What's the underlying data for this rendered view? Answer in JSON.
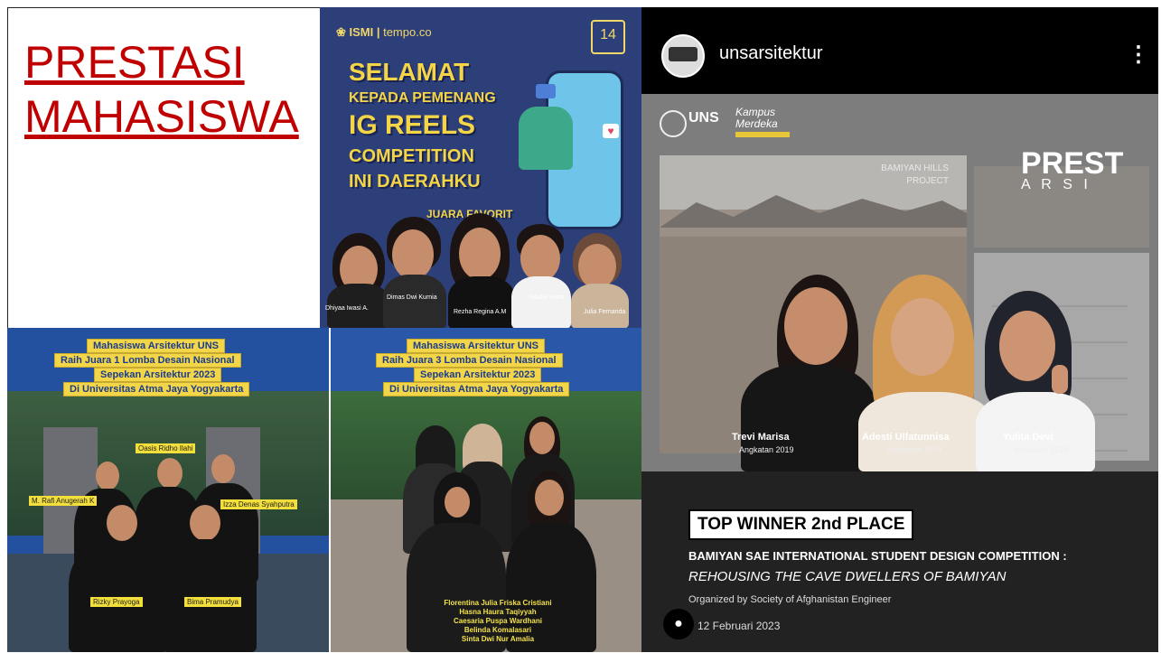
{
  "title": {
    "line1": "PRESTASI",
    "line2": "MAHASISWA"
  },
  "reels": {
    "logo": "tempo.co",
    "headline_1": "SELAMAT",
    "headline_2": "KEPADA PEMENANG",
    "headline_3": "IG REELS",
    "headline_4": "COMPETITION",
    "headline_5": "INI DAERAHKU",
    "subhead": "JUARA FAVORIT",
    "names": [
      "Dhiyaa Iwasi A.",
      "Dimas Dwi Kurnia",
      "Rezha Regina A.M",
      "Naufal Haris",
      "Julia Fernanda"
    ]
  },
  "ig": {
    "username": "unsarsitektur",
    "menu_icon": "more-vertical-icon",
    "logo_uns": "UNS",
    "logo_kampus": "Kampus Merdeka",
    "prest": "PREST",
    "arsi": "A R S I",
    "project": "BAMIYAN HILLS PROJECT",
    "winners": [
      {
        "name": "Trevi Marisa",
        "year": "Angkatan 2019"
      },
      {
        "name": "Adesti Ulfatunnisa",
        "year": "Angkatan 2019"
      },
      {
        "name": "Yulita Devi",
        "year": "Angkatan 2019"
      }
    ],
    "award": "TOP WINNER 2nd PLACE",
    "competition": "BAMIYAN SAE INTERNATIONAL STUDENT DESIGN COMPETITION :",
    "subtitle": "REHOUSING THE CAVE DWELLERS OF BAMIYAN",
    "organizer": "Organized by Society of Afghanistan Engineer",
    "date": "12 Februari 2023",
    "colors": {
      "header": "#000000",
      "panel": "#222222"
    }
  },
  "juara1": {
    "banner": [
      "Mahasiswa Arsitektur UNS",
      "Raih Juara 1 Lomba Desain Nasional",
      "Sepekan Arsitektur 2023",
      "Di Universitas Atma Jaya Yogyakarta"
    ],
    "names": [
      "Oasis Ridho Ilahi",
      "M. Rafi Anugerah K",
      "Izza Denas Syahputra",
      "Rizky Prayoga",
      "Bima Pramudya"
    ]
  },
  "juara3": {
    "banner": [
      "Mahasiswa Arsitektur UNS",
      "Raih Juara 3 Lomba Desain Nasional",
      "Sepekan Arsitektur 2023",
      "Di Universitas Atma Jaya Yogyakarta"
    ],
    "names": [
      "Florentina Julia Friska Cristiani",
      "Hasna Haura Taqiyyah",
      "Caesaria Puspa Wardhani",
      "Belinda Komalasari",
      "Sinta Dwi Nur Amalia"
    ]
  }
}
